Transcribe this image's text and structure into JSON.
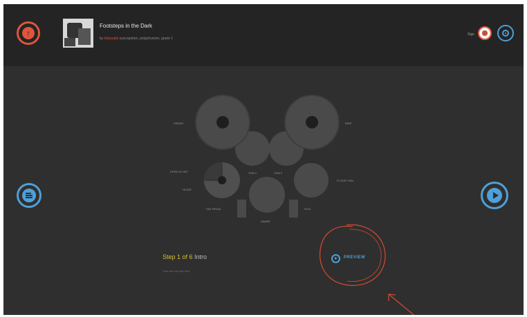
{
  "header": {
    "song_title": "Footsteps in the Dark",
    "meta_prefix": "by",
    "artist": "Isleysatis",
    "meta_rest": "syncopation, polyphonism, grade 1",
    "user_label": "Sign"
  },
  "kit": {
    "labels": {
      "crash": "CRASH",
      "ride": "RIDE",
      "open_hihat": "OPEN HI-HAT",
      "hihat": "HI-HAT",
      "tom1": "TOM 1",
      "tom2": "TOM 2",
      "floor_tom": "FLOOR TOM",
      "hat_pedal": "HAT PEDAL",
      "kick": "KICK",
      "snare": "SNARE"
    }
  },
  "footer": {
    "step_highlight": "Step 1 of 6",
    "step_rest": " Intro",
    "hint": "Start with the first intro",
    "preview_label": "PREVIEW"
  },
  "colors": {
    "accent_red": "#e0553b",
    "accent_blue": "#4fa0d8",
    "step_yellow": "#d4c035"
  }
}
